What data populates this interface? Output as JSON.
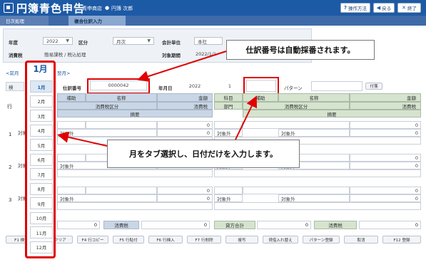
{
  "app": {
    "title": "円簿青色申告",
    "company": "青申商店",
    "user": "円簿 次郎"
  },
  "toolbar": {
    "help": "操作方法",
    "back": "戻る",
    "close": "終了"
  },
  "tabs": [
    "日次処理",
    "複合仕訳入力"
  ],
  "header": {
    "year_label": "年度",
    "year_value": "2022",
    "period_label": "区分",
    "period_value": "月次",
    "unit_label": "会計単位",
    "unit_value": "本社",
    "tax_label": "消費税",
    "tax_value": "簡易課税 / 税込処理",
    "range_label": "対象期間",
    "range_value": "2022/1/1"
  },
  "nav": {
    "prev_month": "<前月",
    "next_month": "翌月>",
    "lock_label": "検"
  },
  "months": {
    "header": "1月",
    "items": [
      "1月",
      "2月",
      "3月",
      "4月",
      "5月",
      "6月",
      "7月",
      "8月",
      "9月",
      "10月",
      "11月",
      "12月"
    ],
    "selected": 0
  },
  "entry": {
    "slip_label": "仕訳番号",
    "slip_value": "0000042",
    "date_label": "年月日",
    "year": "2022",
    "month": "1",
    "pattern_label": "パターン",
    "attach_button": "付箋"
  },
  "grid": {
    "row_header": "行",
    "debit": {
      "sub": "補助",
      "name": "名称",
      "amount": "金額",
      "tax_class": "消費税区分",
      "tax": "消費税",
      "memo": "摘要"
    },
    "credit": {
      "account": "科目",
      "sub": "補助",
      "name": "名称",
      "amount": "金額",
      "dept": "部門",
      "tax_class": "消費税区分",
      "tax": "消費税",
      "memo": "摘要"
    },
    "rows": [
      {
        "no": "1",
        "debit_account": "対象",
        "debit_tax": "対象外",
        "debit_amount": "0",
        "debit_tax_amount": "0",
        "credit_tax": "対象外",
        "credit_tax2": "対象外",
        "credit_amount": "0",
        "credit_tax_amount": "0"
      },
      {
        "no": "2",
        "debit_account": "対象",
        "debit_tax": "対象外",
        "debit_amount": "0",
        "debit_tax_amount": "0",
        "credit_tax": "対象外",
        "credit_tax2": "対象外",
        "credit_amount": "0",
        "credit_tax_amount": "0"
      },
      {
        "no": "3",
        "debit_account": "対象",
        "debit_tax": "対象外",
        "debit_amount": "0",
        "debit_tax_amount": "0",
        "credit_tax": "対象外",
        "credit_tax2": "対象外",
        "credit_amount": "0",
        "credit_tax_amount": "0"
      }
    ]
  },
  "totals": {
    "debit_total": "0",
    "tax_label": "消費税",
    "debit_tax": "0",
    "credit_label": "貸方合計",
    "credit_total": "0",
    "credit_tax_label": "消費税",
    "credit_tax": "0"
  },
  "fkeys": [
    "F1 検索",
    "F2 クリア",
    "F4 行コピー",
    "F5 行貼付",
    "F6 行挿入",
    "F7 行削除",
    "複写",
    "貸借入れ替え",
    "パターン登録",
    "取消",
    "F12 登録"
  ],
  "callouts": {
    "slip": "仕訳番号は自動採番されます。",
    "month": "月をタブ選択し、日付だけを入力します。"
  },
  "colors": {
    "accent": "#1d5aa5",
    "highlight": "#e00000"
  }
}
